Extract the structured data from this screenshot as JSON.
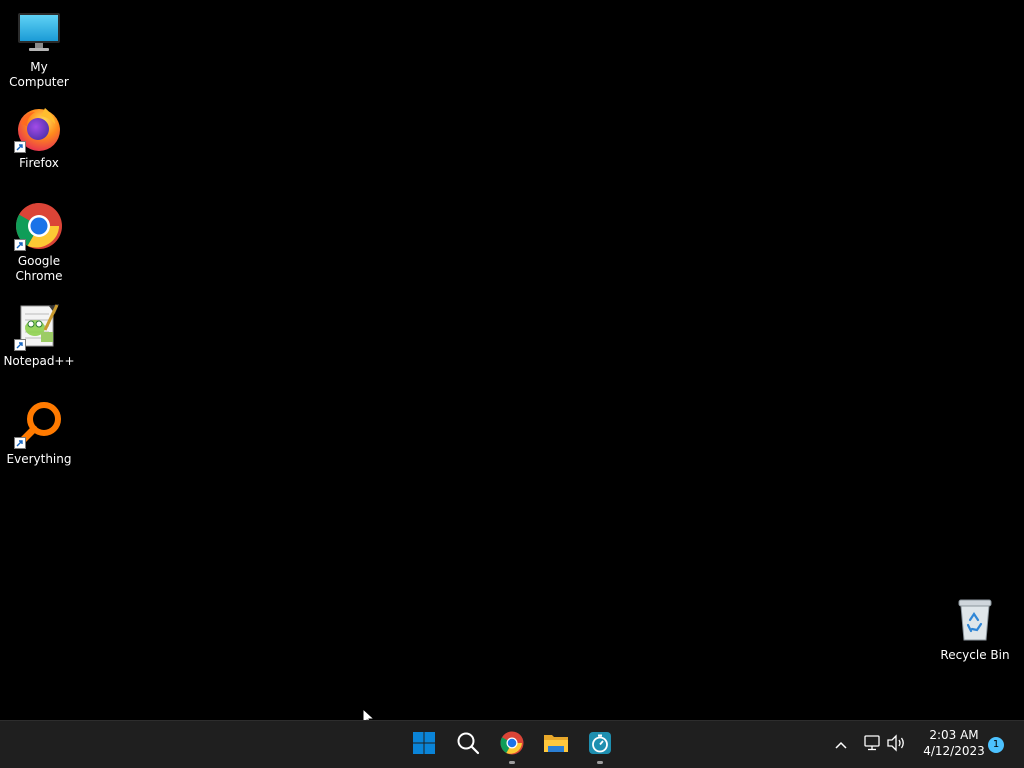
{
  "desktop": {
    "icons": [
      {
        "label": "My Computer",
        "icon": "monitor-icon",
        "shortcut": false
      },
      {
        "label": "Firefox",
        "icon": "firefox-icon",
        "shortcut": true
      },
      {
        "label": "Google Chrome",
        "icon": "chrome-icon",
        "shortcut": true
      },
      {
        "label": "Notepad++",
        "icon": "notepadpp-icon",
        "shortcut": true
      },
      {
        "label": "Everything",
        "icon": "everything-icon",
        "shortcut": true
      }
    ],
    "recycle_bin": {
      "label": "Recycle Bin",
      "icon": "recycle-bin-icon"
    }
  },
  "taskbar": {
    "pinned": [
      {
        "name": "start",
        "icon": "windows-start-icon",
        "running": false
      },
      {
        "name": "search",
        "icon": "search-icon",
        "running": false
      },
      {
        "name": "chrome",
        "icon": "chrome-icon",
        "running": true
      },
      {
        "name": "file-explorer",
        "icon": "folder-icon",
        "running": false
      },
      {
        "name": "timer",
        "icon": "stopwatch-icon",
        "running": true
      }
    ],
    "tray": {
      "chevron_icon": "chevron-up-icon",
      "network_icon": "network-icon",
      "volume_icon": "volume-icon"
    },
    "clock": {
      "time": "2:03 AM",
      "date": "4/12/2023"
    },
    "notification_count": "1"
  },
  "colors": {
    "desktop_bg": "#000000",
    "taskbar_bg": "#1f1f1f",
    "accent": "#4cc2ff",
    "win_blue": "#0a84d8"
  }
}
